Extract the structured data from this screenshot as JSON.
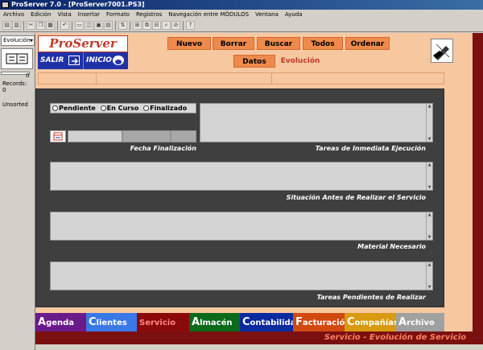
{
  "window": {
    "title": "ProServer 7.0 - [ProServer7001.PS3]"
  },
  "menu": [
    "Archivo",
    "Edición",
    "Vista",
    "Insertar",
    "Formato",
    "Registros",
    "Navegación entre MÓDULOS",
    "Ventana",
    "Ayuda"
  ],
  "left_panel": {
    "view_selector": "Evolución",
    "record_number": "0",
    "records_label": "Records:",
    "records_count": "0",
    "sort_status": "Unsorted"
  },
  "header": {
    "logo": "ProServer 7.0.",
    "salir_label": "Salir",
    "inicio_label": "Inicio",
    "buttons": [
      "Nuevo",
      "Borrar",
      "Buscar",
      "Todos",
      "Ordenar"
    ],
    "tabs": {
      "datos": "Datos",
      "evolucion": "Evolución"
    }
  },
  "status_options": [
    "Pendiente",
    "En Curso",
    "Finalizado"
  ],
  "fields": {
    "fecha_finalizacion": "Fecha Finalización",
    "tareas_inmediata": "Tareas de Inmediata Ejecución",
    "situacion_antes": "Situación Antes de Realizar el Servicio",
    "material": "Material Necesario",
    "tareas_pendientes": "Tareas Pendientes de Realizar"
  },
  "module_tabs": [
    {
      "cap": "A",
      "rest": "genda",
      "color": "#6a1a8a"
    },
    {
      "cap": "C",
      "rest": "lientes",
      "color": "#3a78e8"
    },
    {
      "cap": "",
      "rest": "Servicio",
      "color": "#8a0a0a"
    },
    {
      "cap": "A",
      "rest": "lmacén",
      "color": "#0a6a1a"
    },
    {
      "cap": "C",
      "rest": "ontabilidad",
      "color": "#0a2aa0"
    },
    {
      "cap": "F",
      "rest": "acturación",
      "color": "#d04a10"
    },
    {
      "cap": "C",
      "rest": "ompañías",
      "color": "#d89a10"
    },
    {
      "cap": "A",
      "rest": "rchivo",
      "color": "#a0a0a0"
    }
  ],
  "status_bar": "Servicio - Evolución de Servicio"
}
